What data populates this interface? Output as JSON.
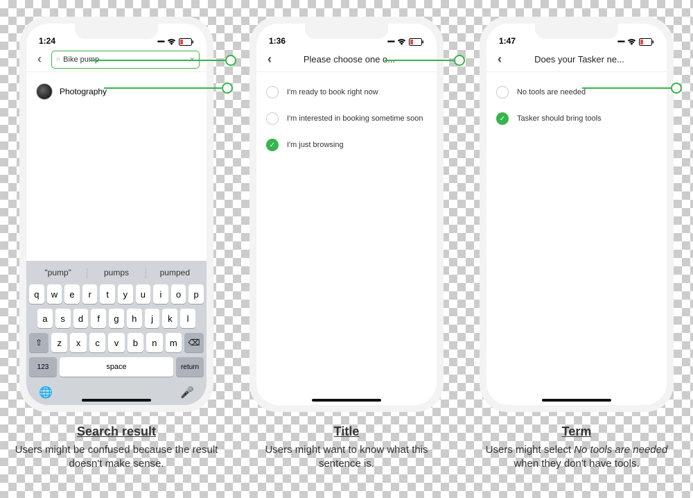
{
  "accent": "#36b54a",
  "phones": {
    "p1": {
      "time": "1:24",
      "search_value": "Bike pump",
      "result": "Photography",
      "suggestions": [
        "\"pump\"",
        "pumps",
        "pumped"
      ],
      "keyboard": {
        "row1": [
          "q",
          "w",
          "e",
          "r",
          "t",
          "y",
          "u",
          "i",
          "o",
          "p"
        ],
        "row2": [
          "a",
          "s",
          "d",
          "f",
          "g",
          "h",
          "j",
          "k",
          "l"
        ],
        "row3": [
          "z",
          "x",
          "c",
          "v",
          "b",
          "n",
          "m"
        ],
        "num": "123",
        "space": "space",
        "return": "return"
      }
    },
    "p2": {
      "time": "1:36",
      "title": "Please choose one o...",
      "options": [
        {
          "label": "I'm ready to book right now",
          "checked": false
        },
        {
          "label": "I'm interested in booking sometime soon",
          "checked": false
        },
        {
          "label": "I'm just browsing",
          "checked": true
        }
      ]
    },
    "p3": {
      "time": "1:47",
      "title": "Does your Tasker ne...",
      "options": [
        {
          "label": "No tools are needed",
          "checked": false
        },
        {
          "label": "Tasker should bring tools",
          "checked": true
        }
      ]
    }
  },
  "captions": {
    "c1": {
      "title": "Search result",
      "body_a": "Users might be confused because the result doesn't make sense."
    },
    "c2": {
      "title": "Title",
      "body_a": "Users might want to know what this sentence is."
    },
    "c3": {
      "title": "Term",
      "body_a": "Users might select ",
      "body_i": "No tools are needed",
      "body_b": " when they don't have tools."
    }
  }
}
